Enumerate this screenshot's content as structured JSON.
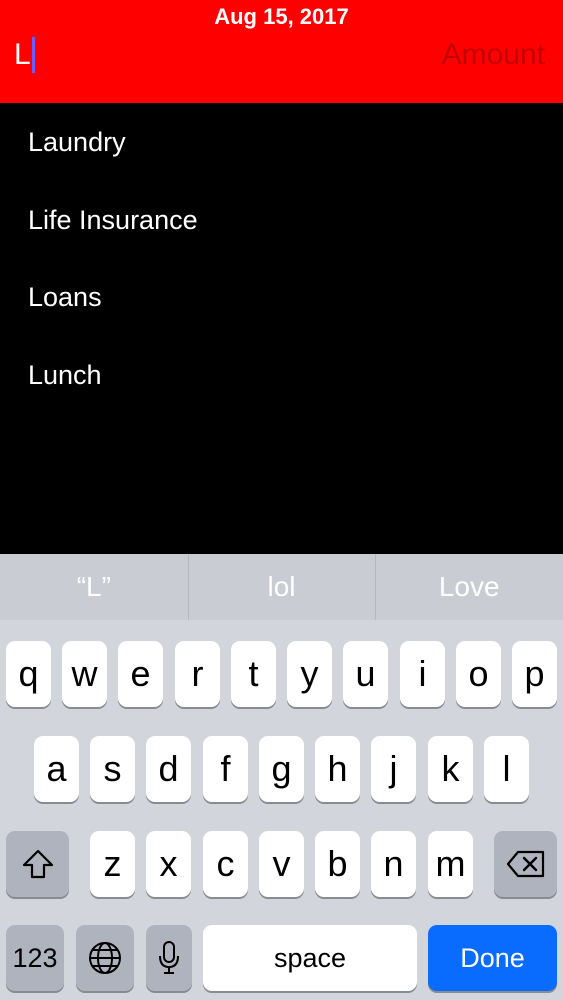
{
  "header": {
    "date": "Aug 15, 2017",
    "name_value": "L",
    "amount_placeholder": "Amount"
  },
  "suggestions": [
    {
      "label": "Laundry"
    },
    {
      "label": "Life Insurance"
    },
    {
      "label": "Loans"
    },
    {
      "label": "Lunch"
    }
  ],
  "predictive": [
    "“L”",
    "lol",
    "Love"
  ],
  "keyboard": {
    "row1": [
      "q",
      "w",
      "e",
      "r",
      "t",
      "y",
      "u",
      "i",
      "o",
      "p"
    ],
    "row2": [
      "a",
      "s",
      "d",
      "f",
      "g",
      "h",
      "j",
      "k",
      "l"
    ],
    "row3": [
      "z",
      "x",
      "c",
      "v",
      "b",
      "n",
      "m"
    ],
    "numbers_label": "123",
    "space_label": "space",
    "done_label": "Done",
    "icons": {
      "shift": "shift-icon",
      "delete": "delete-icon",
      "globe": "globe-icon",
      "mic": "microphone-icon"
    }
  },
  "colors": {
    "header_bg": "#ff0000",
    "done_bg": "#0a6bff",
    "caret": "#6a5cff"
  }
}
